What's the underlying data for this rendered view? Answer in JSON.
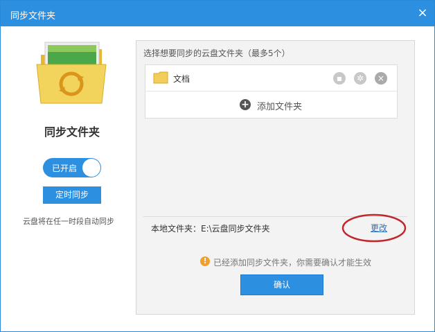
{
  "window": {
    "title": "同步文件夹",
    "close_glyph": "×"
  },
  "left": {
    "title": "同步文件夹",
    "toggle_label": "已开启",
    "timer_button": "定时同步",
    "description": "云盘将在任一时段自动同步"
  },
  "right": {
    "select_hint": "选择想要同步的云盘文件夹（最多5个）",
    "folders": [
      {
        "name": "文档"
      }
    ],
    "add_folder": "添加文件夹",
    "local_folder": "本地文件夹：E:\\云盘同步文件夹",
    "change_link": "更改",
    "warning": "已经添加同步文件夹，你需要确认才能生效",
    "confirm": "确认"
  },
  "colors": {
    "accent": "#2d8fe0",
    "annotation": "#c0272d",
    "warning": "#f0a030"
  }
}
